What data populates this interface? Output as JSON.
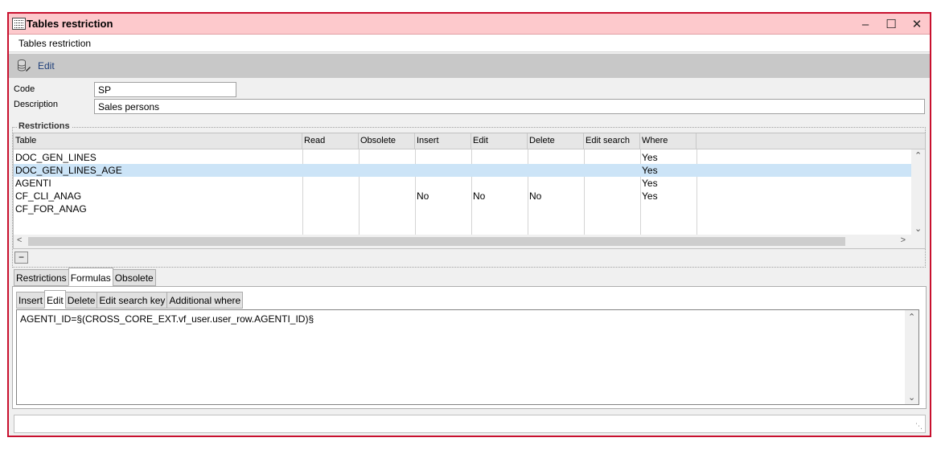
{
  "window": {
    "title": "Tables restriction",
    "subtitle": "Tables restriction",
    "minimize": "–",
    "maximize": "☐",
    "close": "✕",
    "accent_border": "#c8102e",
    "titlebar_bg": "#fdc9cc"
  },
  "toolbar": {
    "edit_label": "Edit",
    "edit_icon": "database-edit-icon"
  },
  "form": {
    "code_label": "Code",
    "code_value": "SP",
    "description_label": "Description",
    "description_value": "Sales persons"
  },
  "restrictions": {
    "group_label": "Restrictions",
    "columns": [
      "Table",
      "Read",
      "Obsolete",
      "Insert",
      "Edit",
      "Delete",
      "Edit search",
      "Where"
    ],
    "rows": [
      {
        "table": "DOC_GEN_LINES",
        "read": "",
        "obsolete": "",
        "insert": "",
        "edit": "",
        "delete": "",
        "edit_search": "",
        "where": "Yes"
      },
      {
        "table": "DOC_GEN_LINES_AGE",
        "read": "",
        "obsolete": "",
        "insert": "",
        "edit": "",
        "delete": "",
        "edit_search": "",
        "where": "Yes"
      },
      {
        "table": "AGENTI",
        "read": "",
        "obsolete": "",
        "insert": "",
        "edit": "",
        "delete": "",
        "edit_search": "",
        "where": "Yes"
      },
      {
        "table": "CF_CLI_ANAG",
        "read": "",
        "obsolete": "",
        "insert": "No",
        "edit": "No",
        "delete": "No",
        "edit_search": "",
        "where": "Yes"
      },
      {
        "table": "CF_FOR_ANAG",
        "read": "",
        "obsolete": "",
        "insert": "",
        "edit": "",
        "delete": "",
        "edit_search": "",
        "where": ""
      }
    ],
    "selected_row": 1,
    "collapse_button": "−"
  },
  "main_tabs": {
    "items": [
      "Restrictions",
      "Formulas",
      "Obsolete"
    ],
    "active": 1
  },
  "sub_tabs": {
    "items": [
      "Insert",
      "Edit",
      "Delete",
      "Edit search key",
      "Additional where"
    ],
    "active": 1
  },
  "formula": {
    "text": "AGENTI_ID=§(CROSS_CORE_EXT.vf_user.user_row.AGENTI_ID)§"
  }
}
